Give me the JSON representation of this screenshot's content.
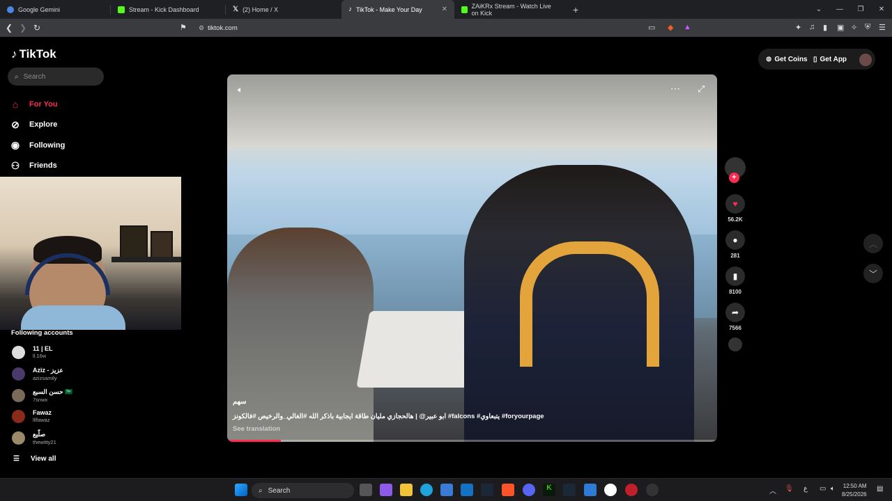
{
  "browser": {
    "tabs": [
      {
        "title": "Google Gemini",
        "color": "#4a86e8"
      },
      {
        "title": "Stream - Kick Dashboard",
        "color": "#53fc18"
      },
      {
        "title": "(2) Home / X",
        "color": "#ffffff"
      },
      {
        "title": "TikTok - Make Your Day",
        "color": "#ffffff",
        "active": true
      },
      {
        "title": "ZAiKRx Stream - Watch Live on Kick",
        "color": "#53fc18"
      }
    ],
    "url": "tiktok.com"
  },
  "tiktok": {
    "logo": "TikTok",
    "search_placeholder": "Search",
    "nav": [
      {
        "label": "For You",
        "icon": "home-icon"
      },
      {
        "label": "Explore",
        "icon": "compass-icon"
      },
      {
        "label": "Following",
        "icon": "following-icon"
      },
      {
        "label": "Friends",
        "icon": "friends-icon"
      }
    ],
    "following_title": "Following accounts",
    "following": [
      {
        "name": "11 | EL",
        "username": "ll.16w"
      },
      {
        "name": "Aziz - عزيز",
        "username": "azizsamily"
      },
      {
        "name": "حسن السبع 🇸🇦",
        "username": "7snwx"
      },
      {
        "name": "Fawaz",
        "username": "lllfawaz"
      },
      {
        "name": "صلّيع",
        "username": "thewitty21"
      }
    ],
    "view_all": "View all",
    "get_coins": "Get Coins",
    "get_app": "Get App",
    "video": {
      "author": "سهم",
      "caption": "ابو عبير@ | هالحجازي مليان طاقة ايجابية باذكر الله #الغالي_والرخيص #فالكونز #falcons #يتبعاوي #foryourpage",
      "see_translation": "See translation",
      "progress": 0.11
    },
    "actions": {
      "likes": "56.2K",
      "comments": "281",
      "saves": "8100",
      "shares": "7566"
    }
  },
  "taskbar": {
    "search": "Search",
    "lang": "ع",
    "time": "12:50 AM",
    "date": "8/25/2026"
  }
}
